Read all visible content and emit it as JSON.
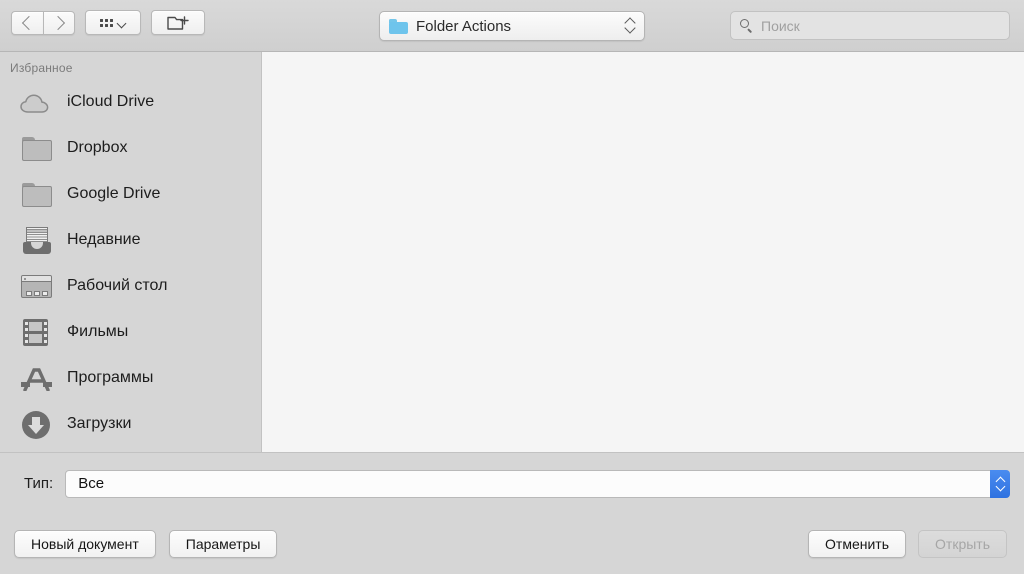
{
  "toolbar": {
    "back_icon": "chevron-left-icon",
    "forward_icon": "chevron-right-icon",
    "view_icon": "grid-view-icon",
    "new_folder_icon": "new-folder-icon",
    "path": {
      "label": "Folder Actions",
      "icon": "blue-folder-icon",
      "stepper_icon": "up-down-chevron-icon"
    },
    "search": {
      "placeholder": "Поиск",
      "value": "",
      "icon": "search-icon"
    }
  },
  "sidebar": {
    "header": "Избранное",
    "items": [
      {
        "label": "iCloud Drive",
        "icon": "cloud-icon"
      },
      {
        "label": "Dropbox",
        "icon": "folder-icon"
      },
      {
        "label": "Google Drive",
        "icon": "folder-icon"
      },
      {
        "label": "Недавние",
        "icon": "recents-tray-icon"
      },
      {
        "label": "Рабочий стол",
        "icon": "desktop-window-icon"
      },
      {
        "label": "Фильмы",
        "icon": "film-strip-icon"
      },
      {
        "label": "Программы",
        "icon": "applications-icon"
      },
      {
        "label": "Загрузки",
        "icon": "downloads-arrow-icon"
      }
    ]
  },
  "filter": {
    "label": "Тип:",
    "value": "Все",
    "stepper_icon": "up-down-chevron-icon"
  },
  "footer": {
    "new_document": "Новый документ",
    "options": "Параметры",
    "cancel": "Отменить",
    "open": "Открыть"
  },
  "colors": {
    "chrome": "#d6d6d6",
    "file_area": "#f5f5f5",
    "accent_blue": "#3a7de8",
    "folder_blue": "#6ec4ec",
    "icon_gray": "#6e6e6e"
  }
}
